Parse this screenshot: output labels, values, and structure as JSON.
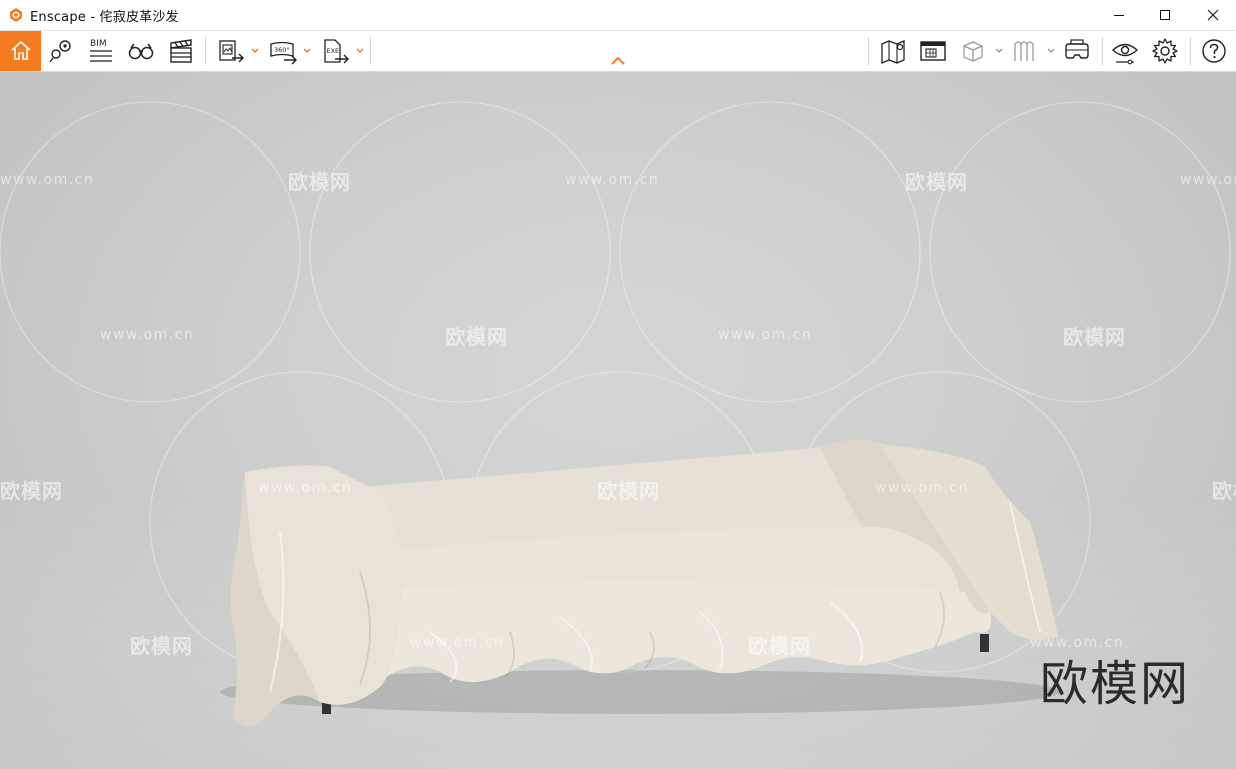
{
  "window": {
    "title": "Enscape - 侘寂皮革沙发",
    "accent_color": "#f47c20"
  },
  "toolbar": {
    "left_buttons": [
      {
        "name": "home",
        "icon": "home-icon",
        "active": true
      },
      {
        "name": "views",
        "icon": "views-marker-icon"
      },
      {
        "name": "bim",
        "icon": "bim-icon",
        "label": "BIM"
      },
      {
        "name": "binoculars",
        "icon": "binoculars-icon"
      },
      {
        "name": "video-editor",
        "icon": "clapperboard-icon"
      }
    ],
    "export_buttons": [
      {
        "name": "batch-render",
        "icon": "batch-render-icon"
      },
      {
        "name": "panorama",
        "icon": "panorama-360-icon",
        "label": "360°"
      },
      {
        "name": "exe-export",
        "icon": "exe-export-icon",
        "label": "EXE"
      }
    ],
    "right_buttons": [
      {
        "name": "map",
        "icon": "map-icon"
      },
      {
        "name": "asset-library",
        "icon": "asset-library-icon"
      },
      {
        "name": "cube",
        "icon": "cube-icon"
      },
      {
        "name": "materials",
        "icon": "materials-icon"
      },
      {
        "name": "vr",
        "icon": "vr-headset-icon"
      },
      {
        "name": "visual-settings",
        "icon": "eye-icon"
      },
      {
        "name": "settings",
        "icon": "gear-icon"
      },
      {
        "name": "help",
        "icon": "help-icon"
      }
    ]
  },
  "viewport": {
    "watermark_brand": "欧模网",
    "watermark_url": "www.om.cn",
    "watermark_big": "欧模网"
  }
}
